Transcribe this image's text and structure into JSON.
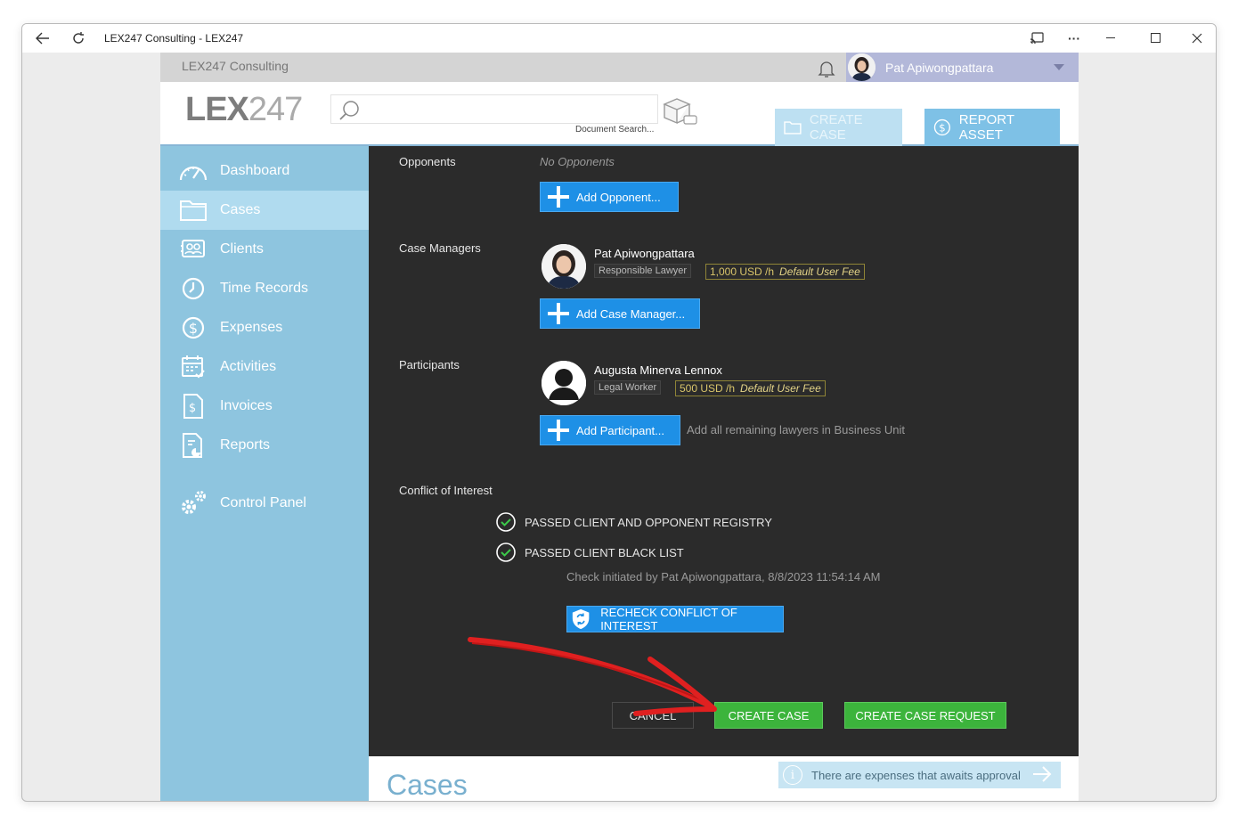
{
  "window": {
    "title": "LEX247 Consulting - LEX247"
  },
  "topbar": {
    "org_name": "LEX247 Consulting",
    "user_name": "Pat Apiwongpattara"
  },
  "header": {
    "logo_bold": "LEX",
    "logo_light": "247",
    "search_placeholder": "",
    "search_label": "Document Search...",
    "create_case": "CREATE CASE",
    "report_asset": "REPORT ASSET"
  },
  "sidebar": {
    "items": [
      {
        "label": "Dashboard",
        "icon": "gauge-icon"
      },
      {
        "label": "Cases",
        "icon": "folder-icon"
      },
      {
        "label": "Clients",
        "icon": "clients-icon"
      },
      {
        "label": "Time Records",
        "icon": "clock-icon"
      },
      {
        "label": "Expenses",
        "icon": "dollar-icon"
      },
      {
        "label": "Activities",
        "icon": "calendar-icon"
      },
      {
        "label": "Invoices",
        "icon": "invoice-icon"
      },
      {
        "label": "Reports",
        "icon": "report-icon"
      },
      {
        "label": "Control Panel",
        "icon": "gears-icon"
      }
    ]
  },
  "form": {
    "opponents": {
      "label": "Opponents",
      "empty": "No Opponents",
      "add": "Add Opponent..."
    },
    "managers": {
      "label": "Case Managers",
      "person": {
        "name": "Pat Apiwongpattara",
        "role": "Responsible Lawyer",
        "fee": "1,000 USD /h",
        "fee_note": "Default User Fee"
      },
      "add": "Add Case Manager..."
    },
    "participants": {
      "label": "Participants",
      "person": {
        "name": "Augusta Minerva Lennox",
        "role": "Legal Worker",
        "fee": "500 USD /h",
        "fee_note": "Default User Fee"
      },
      "add": "Add Participant...",
      "hint": "Add all remaining lawyers in Business Unit"
    },
    "conflict": {
      "label": "Conflict of Interest",
      "checks": [
        "PASSED CLIENT AND OPPONENT REGISTRY",
        "PASSED CLIENT BLACK LIST"
      ],
      "info": "Check initiated by Pat Apiwongpattara, 8/8/2023 11:54:14 AM",
      "recheck": "RECHECK CONFLICT OF INTEREST"
    },
    "actions": {
      "cancel": "CANCEL",
      "create": "CREATE CASE",
      "request": "CREATE CASE REQUEST"
    }
  },
  "page": {
    "title": "Cases",
    "notice": "There are expenses that awaits approval"
  },
  "colors": {
    "sidebar": "#8ec5df",
    "accent_blue": "#1e90e6",
    "success_green": "#3cb43c",
    "annotation_arrow": "#e02020"
  }
}
